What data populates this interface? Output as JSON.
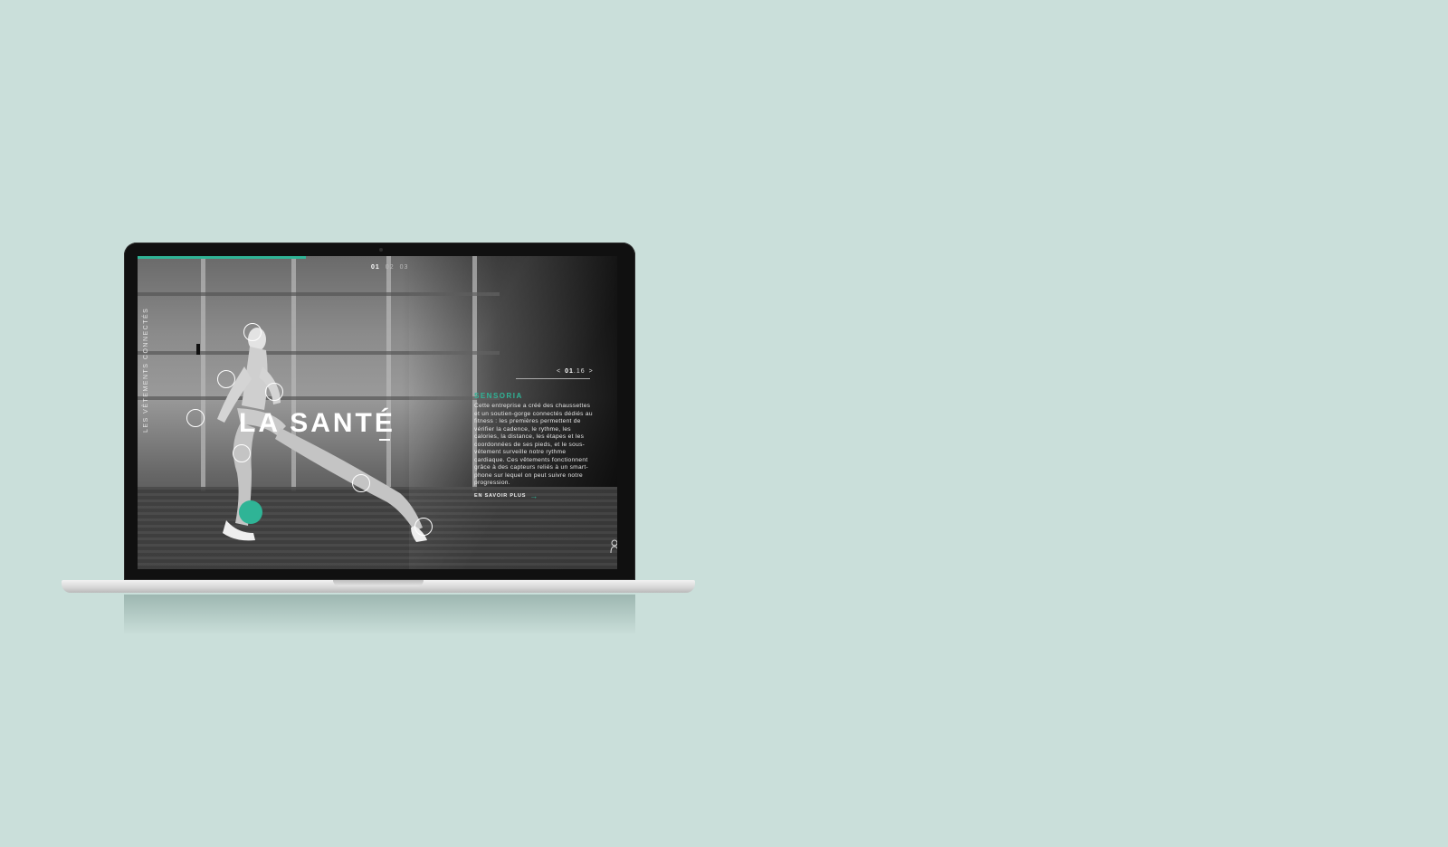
{
  "site": {
    "pager": [
      "01",
      "02",
      "03"
    ],
    "active_page": "01",
    "vertical_label": "LES VÊTEMENTS CONNECTÉS",
    "title": "LA SANTÉ",
    "counter": {
      "prev": "<",
      "current": "01",
      "total": ".16",
      "next": ">"
    },
    "brand": "SENSORIA",
    "description": "Cette entreprise a créé des chaussettes et un soutien-gorge connectés dédiés au fitness : les premières permettent de vérifier la cadence, le rythme, les calories, la distance, les étapes et les coordonnées de ses pieds, et le sous-vêtement surveille notre rythme cardiaque. Ces vêtements fonctionnent grâce à des capteurs reliés à un smart-phone sur lequel on peut suivre notre progression.",
    "more_label": "EN SAVOIR PLUS",
    "accent_color": "#2fb496",
    "progress": 0.35
  }
}
